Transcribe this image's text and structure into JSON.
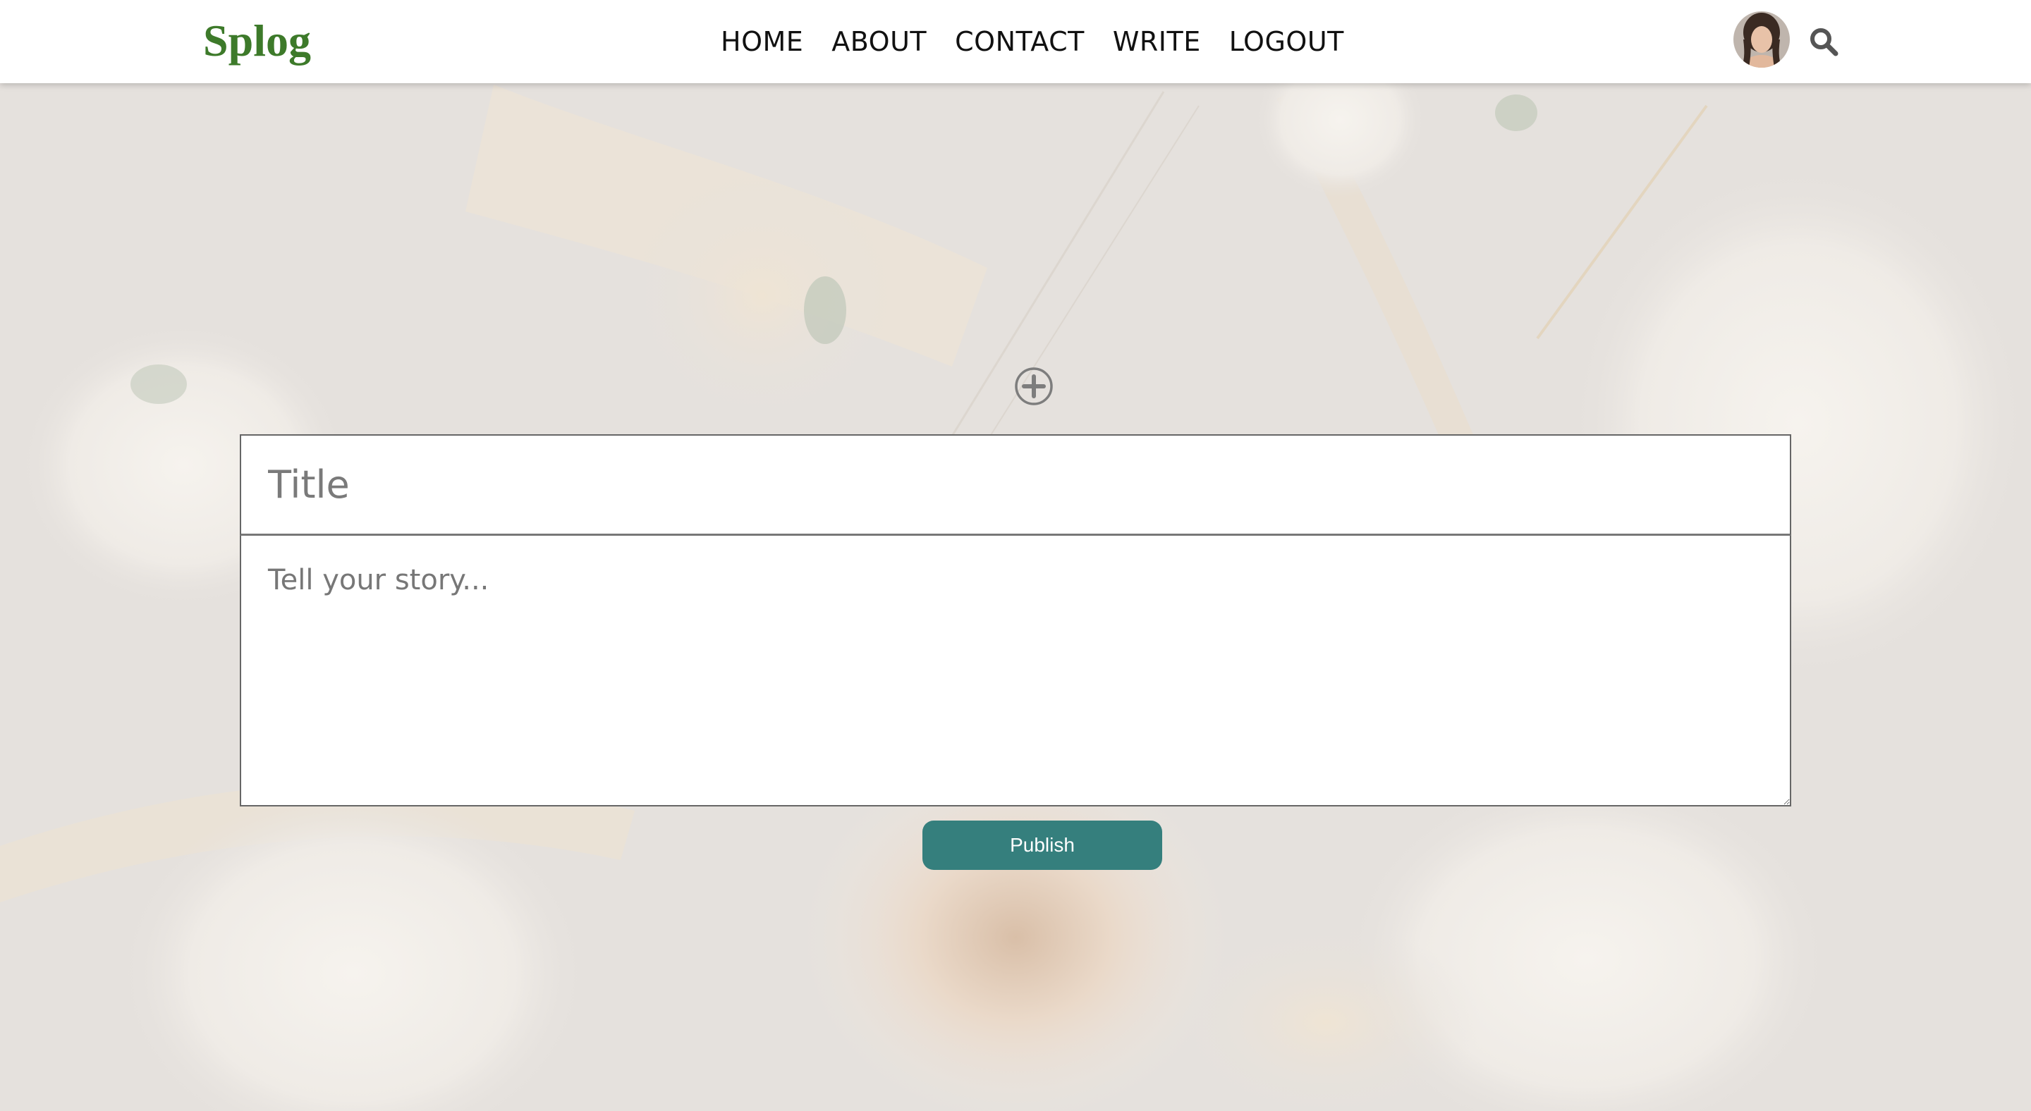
{
  "app": {
    "logo": "Splog"
  },
  "nav": {
    "items": [
      {
        "label": "HOME"
      },
      {
        "label": "ABOUT"
      },
      {
        "label": "CONTACT"
      },
      {
        "label": "WRITE"
      },
      {
        "label": "LOGOUT"
      }
    ]
  },
  "header": {
    "avatar_icon": "user-avatar",
    "search_icon": "search-icon"
  },
  "write_form": {
    "add_media_icon": "plus-circle-icon",
    "title_placeholder": "Title",
    "title_value": "",
    "story_placeholder": "Tell your story...",
    "story_value": "",
    "publish_label": "Publish"
  },
  "colors": {
    "brand": "#3d7a2a",
    "publish_button": "#357f7d",
    "header_bg": "#ffffff",
    "page_bg": "#e6e2de"
  }
}
